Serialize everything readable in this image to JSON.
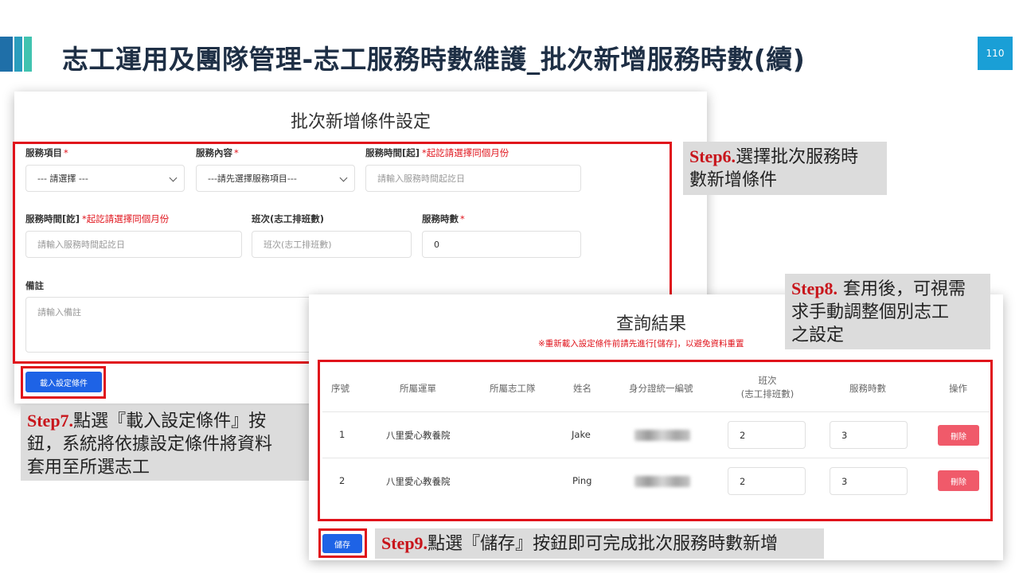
{
  "header": {
    "title": "志工運用及團隊管理-志工服務時數維護_批次新增服務時數(續)",
    "page_number": "110"
  },
  "batch_form": {
    "title": "批次新增條件設定",
    "service_item": {
      "label": "服務項目",
      "required": "*",
      "value": "--- 請選擇 ---"
    },
    "service_content": {
      "label": "服務內容",
      "required": "*",
      "value": "---請先選擇服務項目---"
    },
    "start_time": {
      "label": "服務時間[起]",
      "hint": "*起訖請選擇同個月份",
      "placeholder": "請輸入服務時間起訖日"
    },
    "end_time": {
      "label": "服務時間[訖]",
      "hint": "*起訖請選擇同個月份",
      "placeholder": "請輸入服務時間起訖日"
    },
    "shift": {
      "label": "班次(志工排班數)",
      "placeholder": "班次(志工排班數)"
    },
    "hours": {
      "label": "服務時數",
      "required": "*",
      "value": "0"
    },
    "note": {
      "label": "備註",
      "placeholder": "請輸入備註"
    },
    "load_button": "載入設定條件"
  },
  "callouts": {
    "step6": {
      "step": "Step6.",
      "text1": "選擇批次服務時",
      "text2": "數新增條件"
    },
    "step7": {
      "step": "Step7.",
      "text1": "點選『載入設定條件』按",
      "text2": "鈕，系統將依據設定條件將資料",
      "text3": "套用至所選志工"
    },
    "step8": {
      "step": "Step8.",
      "text1": " 套用後，可視需",
      "text2": "求手動調整個別志工",
      "text3": "之設定"
    },
    "step9": {
      "step": "Step9.",
      "text1": "點選『儲存』按鈕即可完成批次服務時數新增"
    }
  },
  "results": {
    "title": "查詢結果",
    "warning": "※重新載入設定條件前請先進行[儲存]，以避免資料重置",
    "columns": [
      "序號",
      "所屬運單",
      "所屬志工隊",
      "姓名",
      "身分證統一編號",
      "班次",
      "(志工排班數)",
      "服務時數",
      "操作"
    ],
    "rows": [
      {
        "no": "1",
        "unit": "八里愛心教養院",
        "name": "Jake",
        "shift": "2",
        "hours": "3",
        "action": "刪除"
      },
      {
        "no": "2",
        "unit": "八里愛心教養院",
        "name": "Ping",
        "shift": "2",
        "hours": "3",
        "action": "刪除"
      }
    ],
    "save_button": "儲存"
  }
}
